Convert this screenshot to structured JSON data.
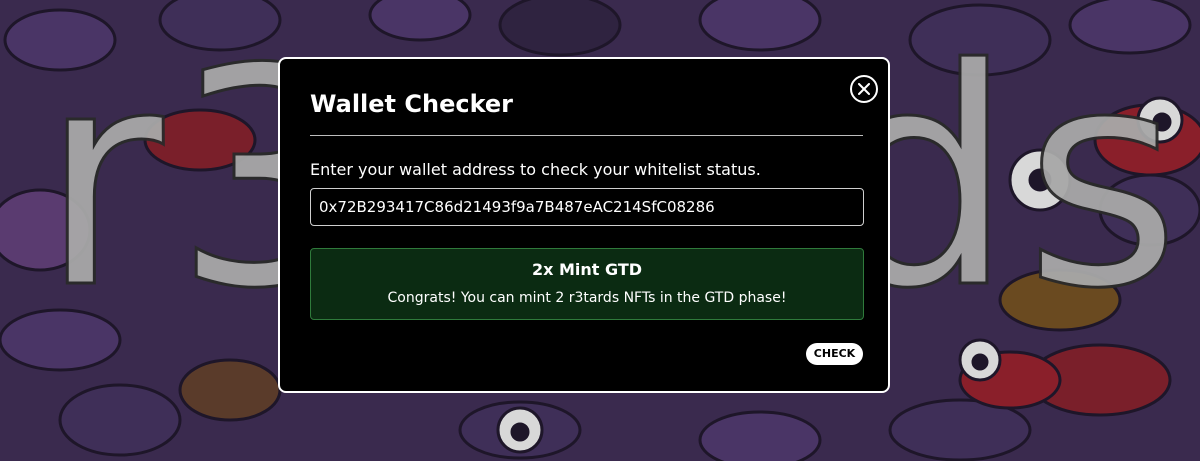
{
  "background": {
    "logo_text": "r3tards",
    "base_color": "#3a2a4e"
  },
  "modal": {
    "title": "Wallet Checker",
    "close_icon": "close-icon",
    "prompt": "Enter your wallet address to check your whitelist status.",
    "wallet_input": {
      "value": "0x72B293417C86d21493f9a7B487eAC214SfC08286"
    },
    "result": {
      "title": "2x Mint GTD",
      "message": "Congrats! You can mint 2 r3tards NFTs in the GTD phase!",
      "color": "#0b2b12",
      "border_color": "#2f7a3b"
    },
    "check_label": "CHECK"
  }
}
